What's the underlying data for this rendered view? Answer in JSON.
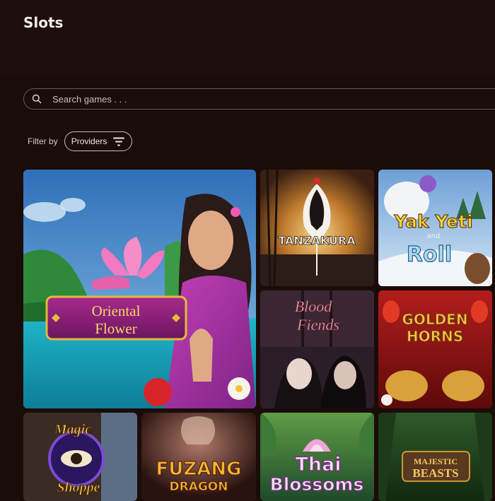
{
  "page": {
    "title": "Slots"
  },
  "search": {
    "placeholder": "Search games . . ."
  },
  "filter": {
    "label": "Filter by",
    "providers_label": "Providers"
  },
  "games": [
    {
      "title_line1": "Oriental",
      "title_line2": "Flower"
    },
    {
      "title": "TANZAKURA"
    },
    {
      "title_line1": "Yak Yeti",
      "title_small": "and",
      "title_line2": "Roll"
    },
    {
      "title_line1": "Blood",
      "title_line2": "Fiends"
    },
    {
      "title_line1": "GOLDEN",
      "title_line2": "HORNS"
    },
    {
      "title_line1": "Magic",
      "title_line2": "Shoppe"
    },
    {
      "title_line1": "FUZANG",
      "title_line2": "DRAGON"
    },
    {
      "title_line1": "Thai",
      "title_line2": "Blossoms"
    },
    {
      "title_line1": "MAJESTIC",
      "title_line2": "BEASTS"
    }
  ]
}
